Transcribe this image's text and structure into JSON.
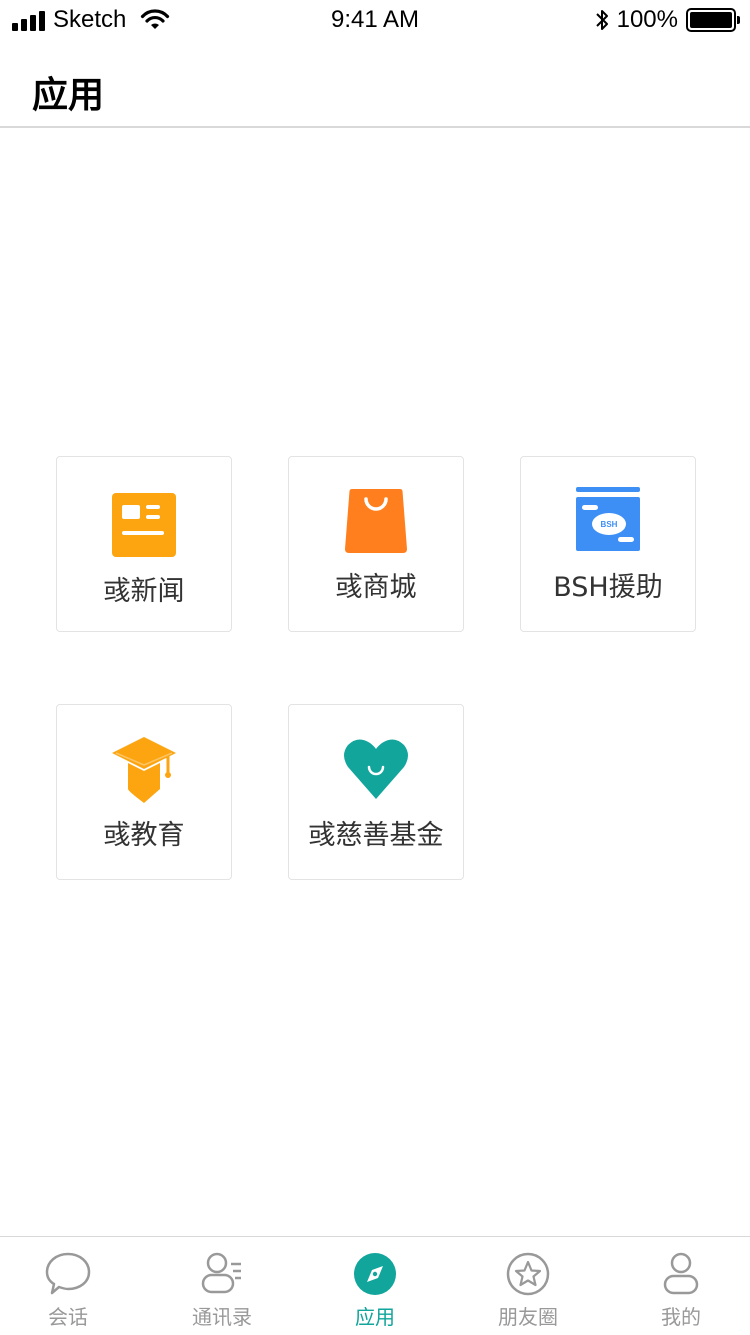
{
  "status_bar": {
    "carrier": "Sketch",
    "time": "9:41 AM",
    "battery": "100%"
  },
  "header": {
    "title": "应用"
  },
  "apps": [
    {
      "label": "彧新闻",
      "icon": "news-icon",
      "color": "#fca510"
    },
    {
      "label": "彧商城",
      "icon": "shopping-bag-icon",
      "color": "#ff7f1e"
    },
    {
      "label": "BSH援助",
      "icon": "bsh-aid-icon",
      "icon_text": "BSH",
      "color": "#3e8ff5"
    },
    {
      "label": "彧教育",
      "icon": "graduation-cap-icon",
      "color": "#fca510"
    },
    {
      "label": "彧慈善基金",
      "icon": "heart-icon",
      "color": "#12a59b"
    }
  ],
  "tab_bar": {
    "active_color": "#12a59b",
    "inactive_color": "#999999",
    "tabs": [
      {
        "label": "会话",
        "icon": "chat-bubble-icon",
        "active": false
      },
      {
        "label": "通讯录",
        "icon": "contacts-icon",
        "active": false
      },
      {
        "label": "应用",
        "icon": "compass-icon",
        "active": true
      },
      {
        "label": "朋友圈",
        "icon": "star-icon",
        "active": false
      },
      {
        "label": "我的",
        "icon": "person-icon",
        "active": false
      }
    ]
  }
}
